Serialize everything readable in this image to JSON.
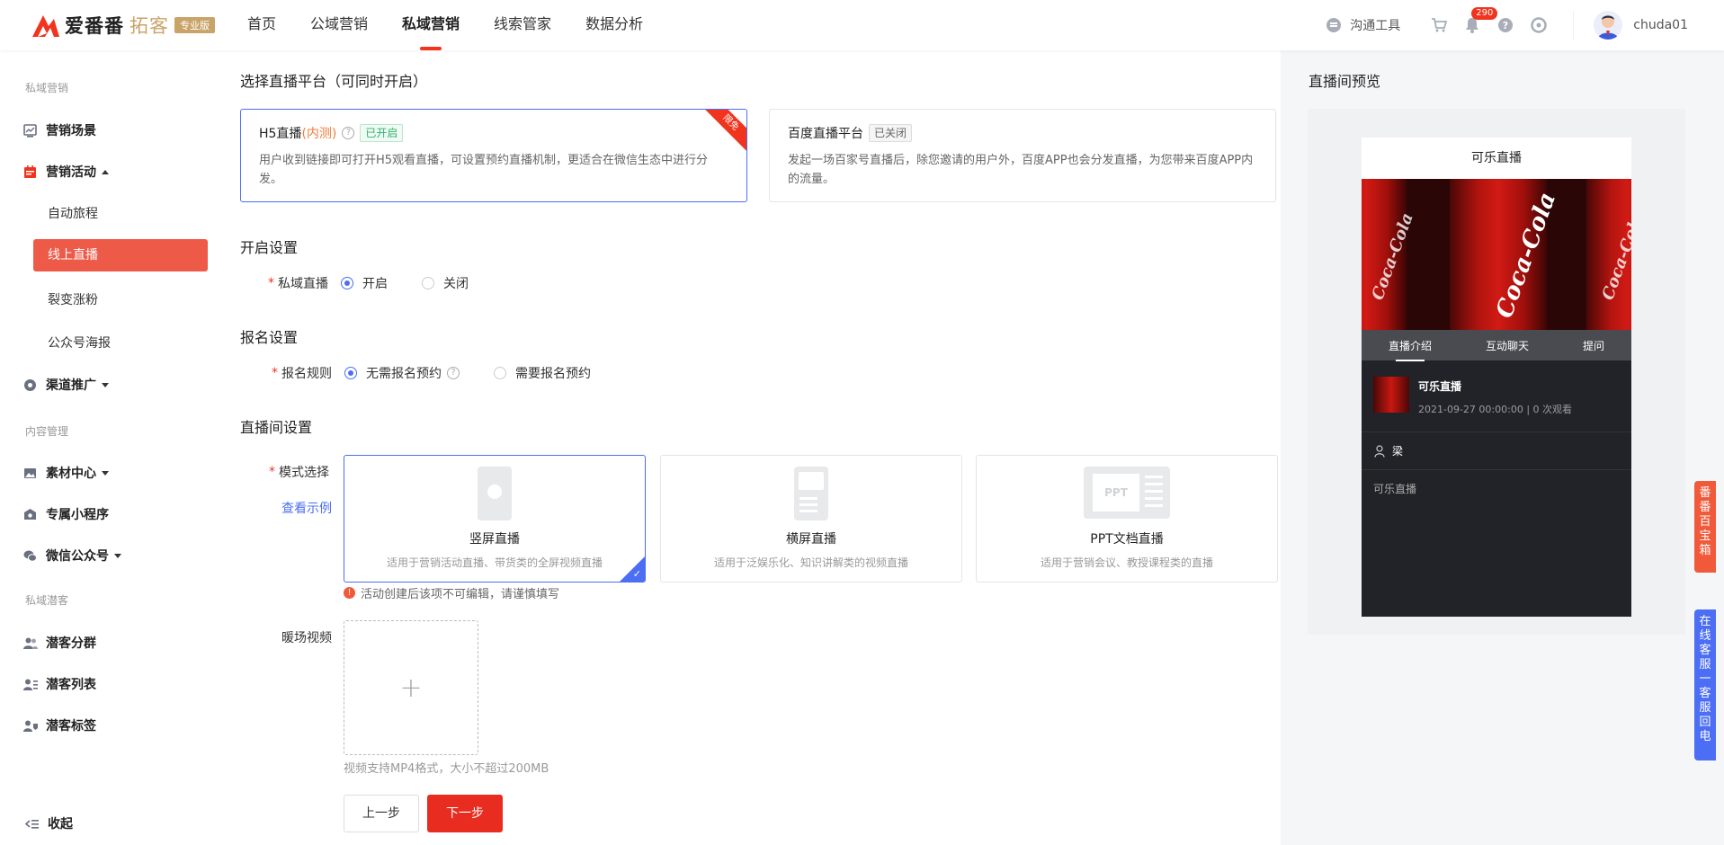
{
  "header": {
    "logo_text": "爱番番",
    "logo_sub": "拓客",
    "logo_badge": "专业版",
    "nav": [
      "首页",
      "公域营销",
      "私域营销",
      "线索管家",
      "数据分析"
    ],
    "tool_label": "沟通工具",
    "bell_count": "290",
    "username": "chuda01"
  },
  "sidebar": {
    "group1": "私域营销",
    "item_scene": "营销场景",
    "item_activity": "营销活动",
    "sub_journey": "自动旅程",
    "sub_live": "线上直播",
    "sub_fission": "裂变涨粉",
    "sub_poster": "公众号海报",
    "item_channel": "渠道推广",
    "group2": "内容管理",
    "item_material": "素材中心",
    "item_miniapp": "专属小程序",
    "item_wechat": "微信公众号",
    "group3": "私域潜客",
    "item_segment": "潜客分群",
    "item_list": "潜客列表",
    "item_tags": "潜客标签",
    "collapse": "收起"
  },
  "platform": {
    "title": "选择直播平台（可同时开启）",
    "h5": {
      "name": "H5直播",
      "note": "(内测)",
      "status": "已开启",
      "desc": "用户收到链接即可打开H5观看直播，可设置预约直播机制，更适合在微信生态中进行分发。",
      "ribbon": "限免"
    },
    "baidu": {
      "name": "百度直播平台",
      "status": "已关闭",
      "desc": "发起一场百家号直播后，除您邀请的用户外，百度APP也会分发直播，为您带来百度APP内的流量。"
    }
  },
  "open": {
    "title": "开启设置",
    "label": "私域直播",
    "on": "开启",
    "off": "关闭"
  },
  "signup": {
    "title": "报名设置",
    "label": "报名规则",
    "opt1": "无需报名预约",
    "opt2": "需要报名预约"
  },
  "room": {
    "title": "直播间设置",
    "mode_label": "模式选择",
    "example_link": "查看示例",
    "modes": [
      {
        "name": "竖屏直播",
        "desc": "适用于营销活动直播、带货类的全屏视频直播"
      },
      {
        "name": "横屏直播",
        "desc": "适用于泛娱乐化、知识讲解类的视频直播"
      },
      {
        "name": "PPT文档直播",
        "desc": "适用于营销会议、教授课程类的直播"
      }
    ],
    "warning": "活动创建后该项不可编辑，请谨慎填写",
    "video_label": "暖场视频",
    "upload_plus": "+",
    "upload_hint": "视频支持MP4格式，大小不超过200MB",
    "prev": "上一步",
    "next": "下一步"
  },
  "preview": {
    "title": "直播间预览",
    "phone_title": "可乐直播",
    "tabs": [
      "直播介绍",
      "互动聊天",
      "提问"
    ],
    "info_title": "可乐直播",
    "info_meta": "2021-09-27 00:00:00 | 0 次观看",
    "host": "梁",
    "desc": "可乐直播"
  },
  "float": {
    "red": "番番百宝箱",
    "blue": "在线客服一客服回电"
  },
  "colors": {
    "brand_red": "#f0341e",
    "accent_blue": "#4c6ef5",
    "gold": "#c9a46a"
  }
}
